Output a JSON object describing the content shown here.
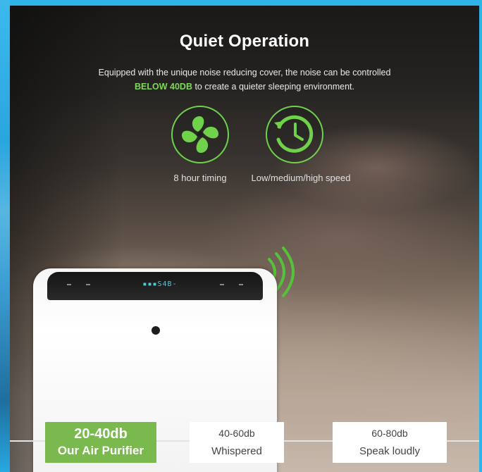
{
  "header": {
    "title": "Quiet Operation",
    "desc_part1": "Equipped with the unique noise reducing cover, the noise can be controlled",
    "desc_highlight": "BELOW 40DB",
    "desc_part2": " to create a quieter sleeping environment."
  },
  "features": [
    {
      "icon": "fan-icon",
      "label": "8 hour timing"
    },
    {
      "icon": "clock-icon",
      "label": "Low/medium/high speed"
    }
  ],
  "device": {
    "display_text": "▪▪▪S4B-"
  },
  "noise_levels": [
    {
      "range": "20-40db",
      "label": "Our Air Purifier",
      "color": "#7ab94e"
    },
    {
      "range": "40-60db",
      "label": "Whispered",
      "color": "#ffffff"
    },
    {
      "range": "60-80db",
      "label": "Speak loudly",
      "color": "#ffffff"
    }
  ],
  "colors": {
    "accent_green": "#7ed957",
    "frame_blue": "#2fb4ea"
  }
}
